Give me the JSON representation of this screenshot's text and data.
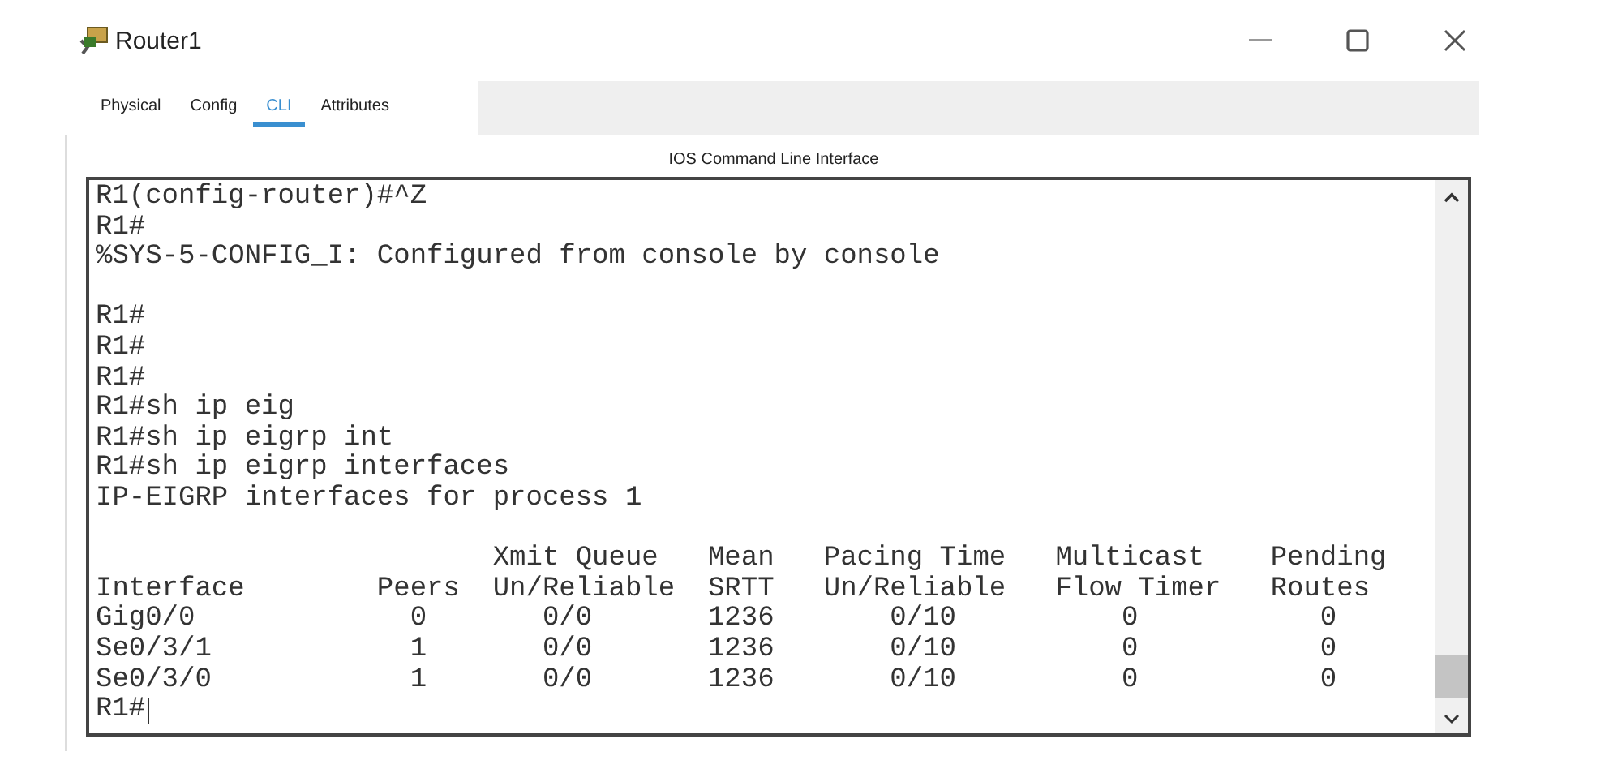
{
  "window": {
    "title": "Router1"
  },
  "tabs": [
    {
      "label": "Physical",
      "selected": false
    },
    {
      "label": "Config",
      "selected": false
    },
    {
      "label": "CLI",
      "selected": true
    },
    {
      "label": "Attributes",
      "selected": false
    }
  ],
  "panel_title": "IOS Command Line Interface",
  "console": {
    "lines": [
      {
        "kind": "text",
        "text": "R1(config-router)#^Z"
      },
      {
        "kind": "text",
        "text": "R1#"
      },
      {
        "kind": "text",
        "text": "%SYS-5-CONFIG_I: Configured from console by console"
      },
      {
        "kind": "blank"
      },
      {
        "kind": "text",
        "text": "R1#"
      },
      {
        "kind": "text",
        "text": "R1#"
      },
      {
        "kind": "text",
        "text": "R1#"
      },
      {
        "kind": "text",
        "text": "R1#sh ip eig"
      },
      {
        "kind": "text",
        "text": "R1#sh ip eigrp int"
      },
      {
        "kind": "text",
        "text": "R1#sh ip eigrp interfaces"
      },
      {
        "kind": "text",
        "text": "IP-EIGRP interfaces for process 1"
      },
      {
        "kind": "blank"
      },
      {
        "kind": "text",
        "text": "                        Xmit Queue   Mean   Pacing Time   Multicast    Pending"
      },
      {
        "kind": "text",
        "text": "Interface        Peers  Un/Reliable  SRTT   Un/Reliable   Flow Timer   Routes"
      },
      {
        "kind": "text",
        "text": "Gig0/0             0       0/0       1236       0/10          0           0"
      },
      {
        "kind": "text",
        "text": "Se0/3/1            1       0/0       1236       0/10          0           0"
      },
      {
        "kind": "text",
        "text": "Se0/3/0            1       0/0       1236       0/10          0           0"
      },
      {
        "kind": "prompt",
        "text": "R1#"
      }
    ]
  }
}
